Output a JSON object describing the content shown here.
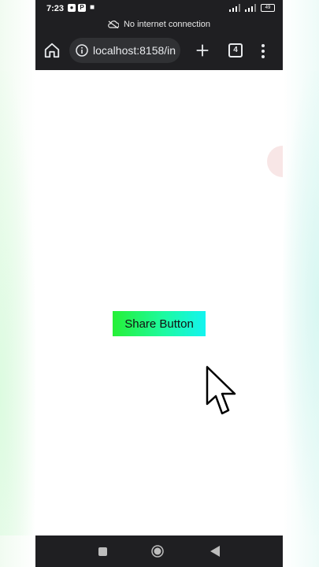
{
  "status_bar": {
    "time": "7:23",
    "icons": [
      "alarm-icon",
      "p-app-icon",
      "video-icon"
    ],
    "battery": "49"
  },
  "offline_banner": {
    "text": "No internet connection"
  },
  "browser": {
    "url": "localhost:8158/in",
    "tab_count": "4"
  },
  "page": {
    "share_button_label": "Share Button",
    "share_button_colors": [
      "#26f036",
      "#13f4f0"
    ]
  },
  "nav_bar": {
    "icons": [
      "recents-icon",
      "home-icon",
      "back-icon"
    ]
  }
}
